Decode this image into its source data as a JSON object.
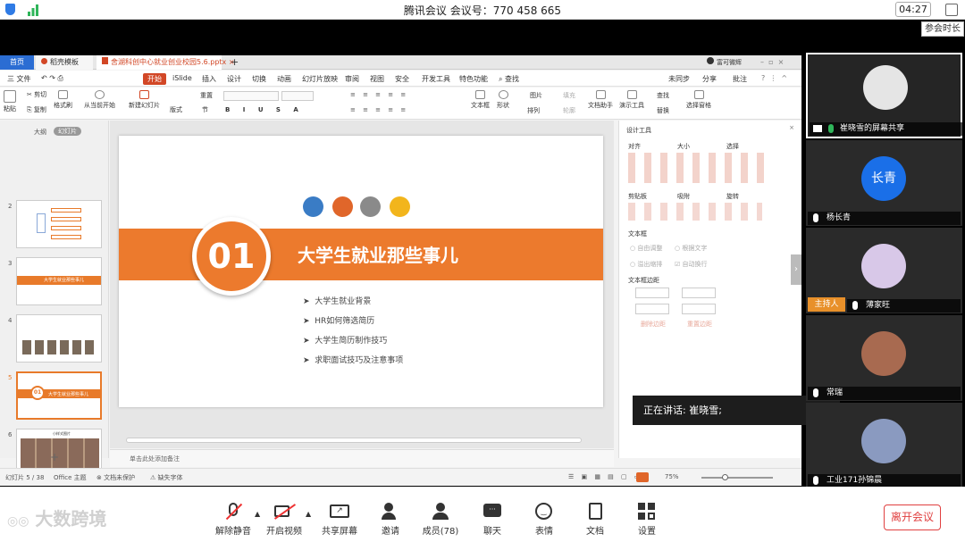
{
  "top": {
    "title": "腾讯会议 会议号：770 458 665",
    "time": "04:27",
    "timer": "参会时长"
  },
  "wps": {
    "tabs": [
      "首页",
      "稻壳模板",
      "舍湖科创中心就业创业校园5.6.pptx"
    ],
    "menus": [
      "三 文件",
      "开始",
      "iSlide",
      "插入",
      "设计",
      "切换",
      "动画",
      "幻灯片放映",
      "审阅",
      "视图",
      "安全",
      "开发工具",
      "特色功能",
      "查找"
    ],
    "right_menus": [
      "未同步",
      "分享",
      "批注"
    ],
    "user": "富可微辉",
    "ribbon": [
      "粘贴",
      "剪切",
      "复制",
      "格式刷",
      "从当前开始",
      "新建幻灯片",
      "版式",
      "节",
      "重置",
      "文本框",
      "形状",
      "排列",
      "图片",
      "填充",
      "轮廓",
      "文档助手",
      "演示工具",
      "查找",
      "替换",
      "选择窗格"
    ],
    "panel_tabs": [
      "大纲",
      "幻灯片"
    ],
    "thumb_numbers": [
      "2",
      "3",
      "4",
      "5",
      "6",
      "7"
    ],
    "thumb_texts": {
      "t3": "大学生就业那些事儿",
      "t5": "大学生就业那些事儿",
      "t6": "小样式图片"
    },
    "slide": {
      "num": "01",
      "title": "大学生就业那些事儿",
      "bullets": [
        "大学生就业背景",
        "HR如何筛选简历",
        "大学生简历制作技巧",
        "求职面试技巧及注意事项"
      ]
    },
    "notes": "单击此处添加备注",
    "design": {
      "title": "设计工具",
      "groups": [
        "对齐",
        "大小",
        "选择",
        "剪贴板",
        "吸附",
        "旋转"
      ],
      "textbox": "文本框",
      "opts": [
        "自由调整",
        "根据文字",
        "溢出缩排",
        "自动换行"
      ],
      "margin": "文本框边距",
      "links": [
        "删除边距",
        "重置边距"
      ]
    },
    "status": {
      "slide": "幻灯片 5 / 38",
      "theme": "Office 主题",
      "protect": "文档未保护",
      "font": "缺失字体",
      "zoom": "75%"
    }
  },
  "speaking": "正在讲话: 崔晓雪;",
  "participants": [
    {
      "name": "崔晓雪的屏幕共享"
    },
    {
      "name": "杨长青",
      "avatar": "长青"
    },
    {
      "name": "薄家旺",
      "host": "主持人"
    },
    {
      "name": "常瑞"
    },
    {
      "name": "工业171孙锦晨"
    }
  ],
  "toolbar": [
    "解除静音",
    "开启视频",
    "共享屏幕",
    "邀请",
    "成员(78)",
    "聊天",
    "表情",
    "文档",
    "设置"
  ],
  "leave": "离开会议",
  "watermark": "大数跨境",
  "colors": {
    "accent": "#e87a2a",
    "host": "#e8902a",
    "blue_avatar": "#1a6fe8",
    "leave": "#e04040"
  }
}
